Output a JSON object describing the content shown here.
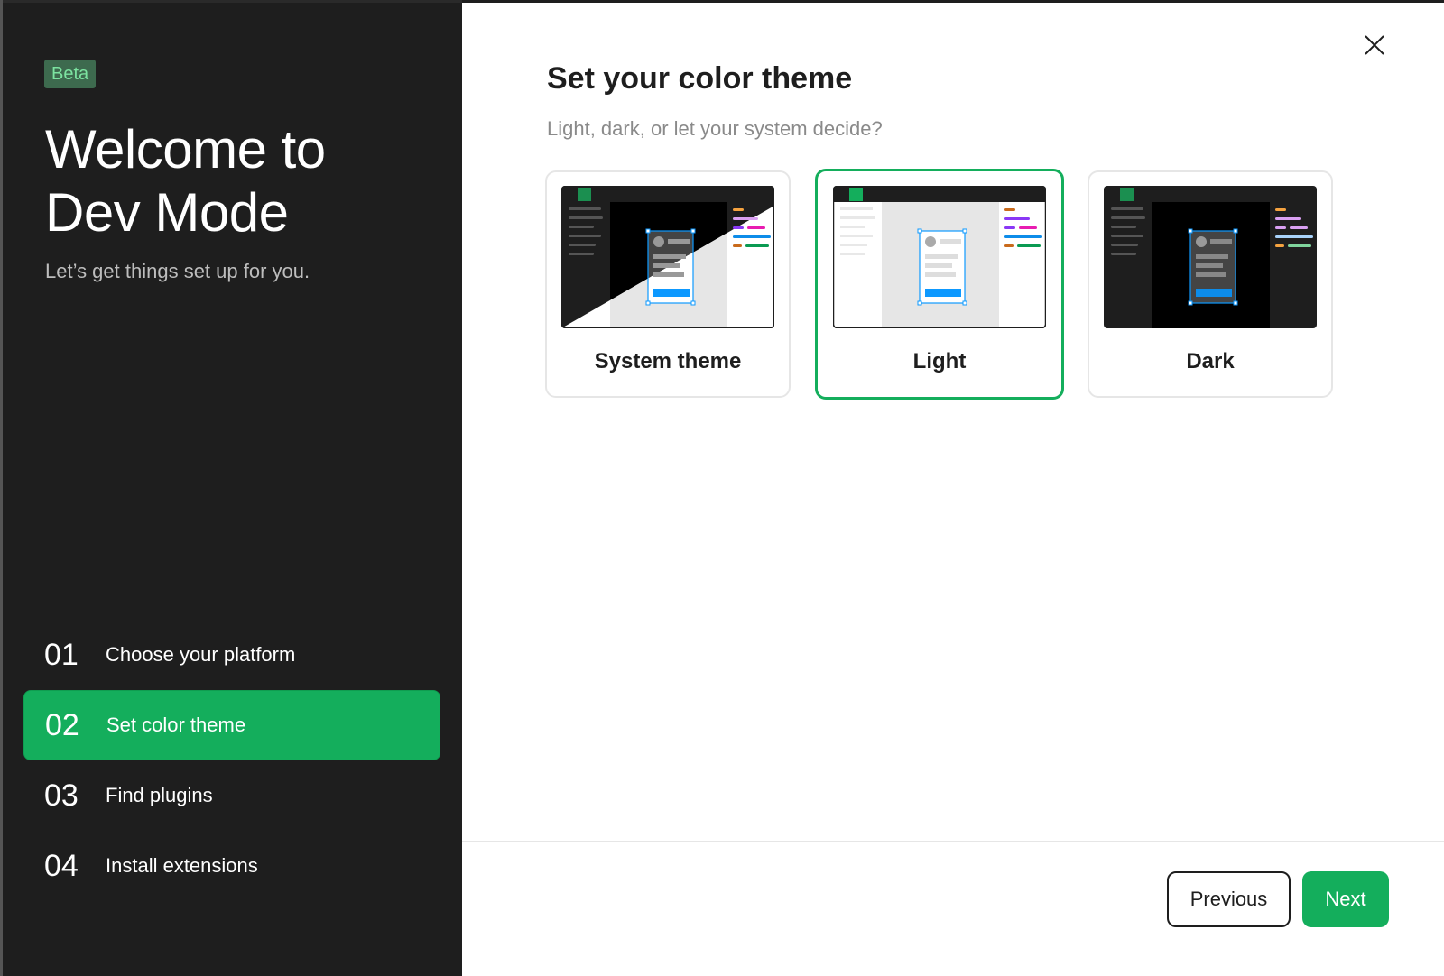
{
  "sidebar": {
    "badge": "Beta",
    "title_line1": "Welcome to",
    "title_line2": "Dev Mode",
    "subtitle": "Let’s get things set up for you.",
    "steps": [
      {
        "num": "01",
        "label": "Choose your platform",
        "active": false
      },
      {
        "num": "02",
        "label": "Set color theme",
        "active": true
      },
      {
        "num": "03",
        "label": "Find plugins",
        "active": false
      },
      {
        "num": "04",
        "label": "Install extensions",
        "active": false
      }
    ]
  },
  "main": {
    "close_icon": "close-icon",
    "title": "Set your color theme",
    "description": "Light, dark, or let your system decide?",
    "themes": [
      {
        "id": "system",
        "label": "System theme",
        "selected": false
      },
      {
        "id": "light",
        "label": "Light",
        "selected": true
      },
      {
        "id": "dark",
        "label": "Dark",
        "selected": false
      }
    ]
  },
  "footer": {
    "previous_label": "Previous",
    "next_label": "Next"
  },
  "colors": {
    "accent": "#14ae5c",
    "sidebar_bg": "#1e1e1e",
    "badge_bg": "#3d6a4e",
    "badge_text": "#7ce3a0",
    "selection_blue": "#0d99ff"
  }
}
